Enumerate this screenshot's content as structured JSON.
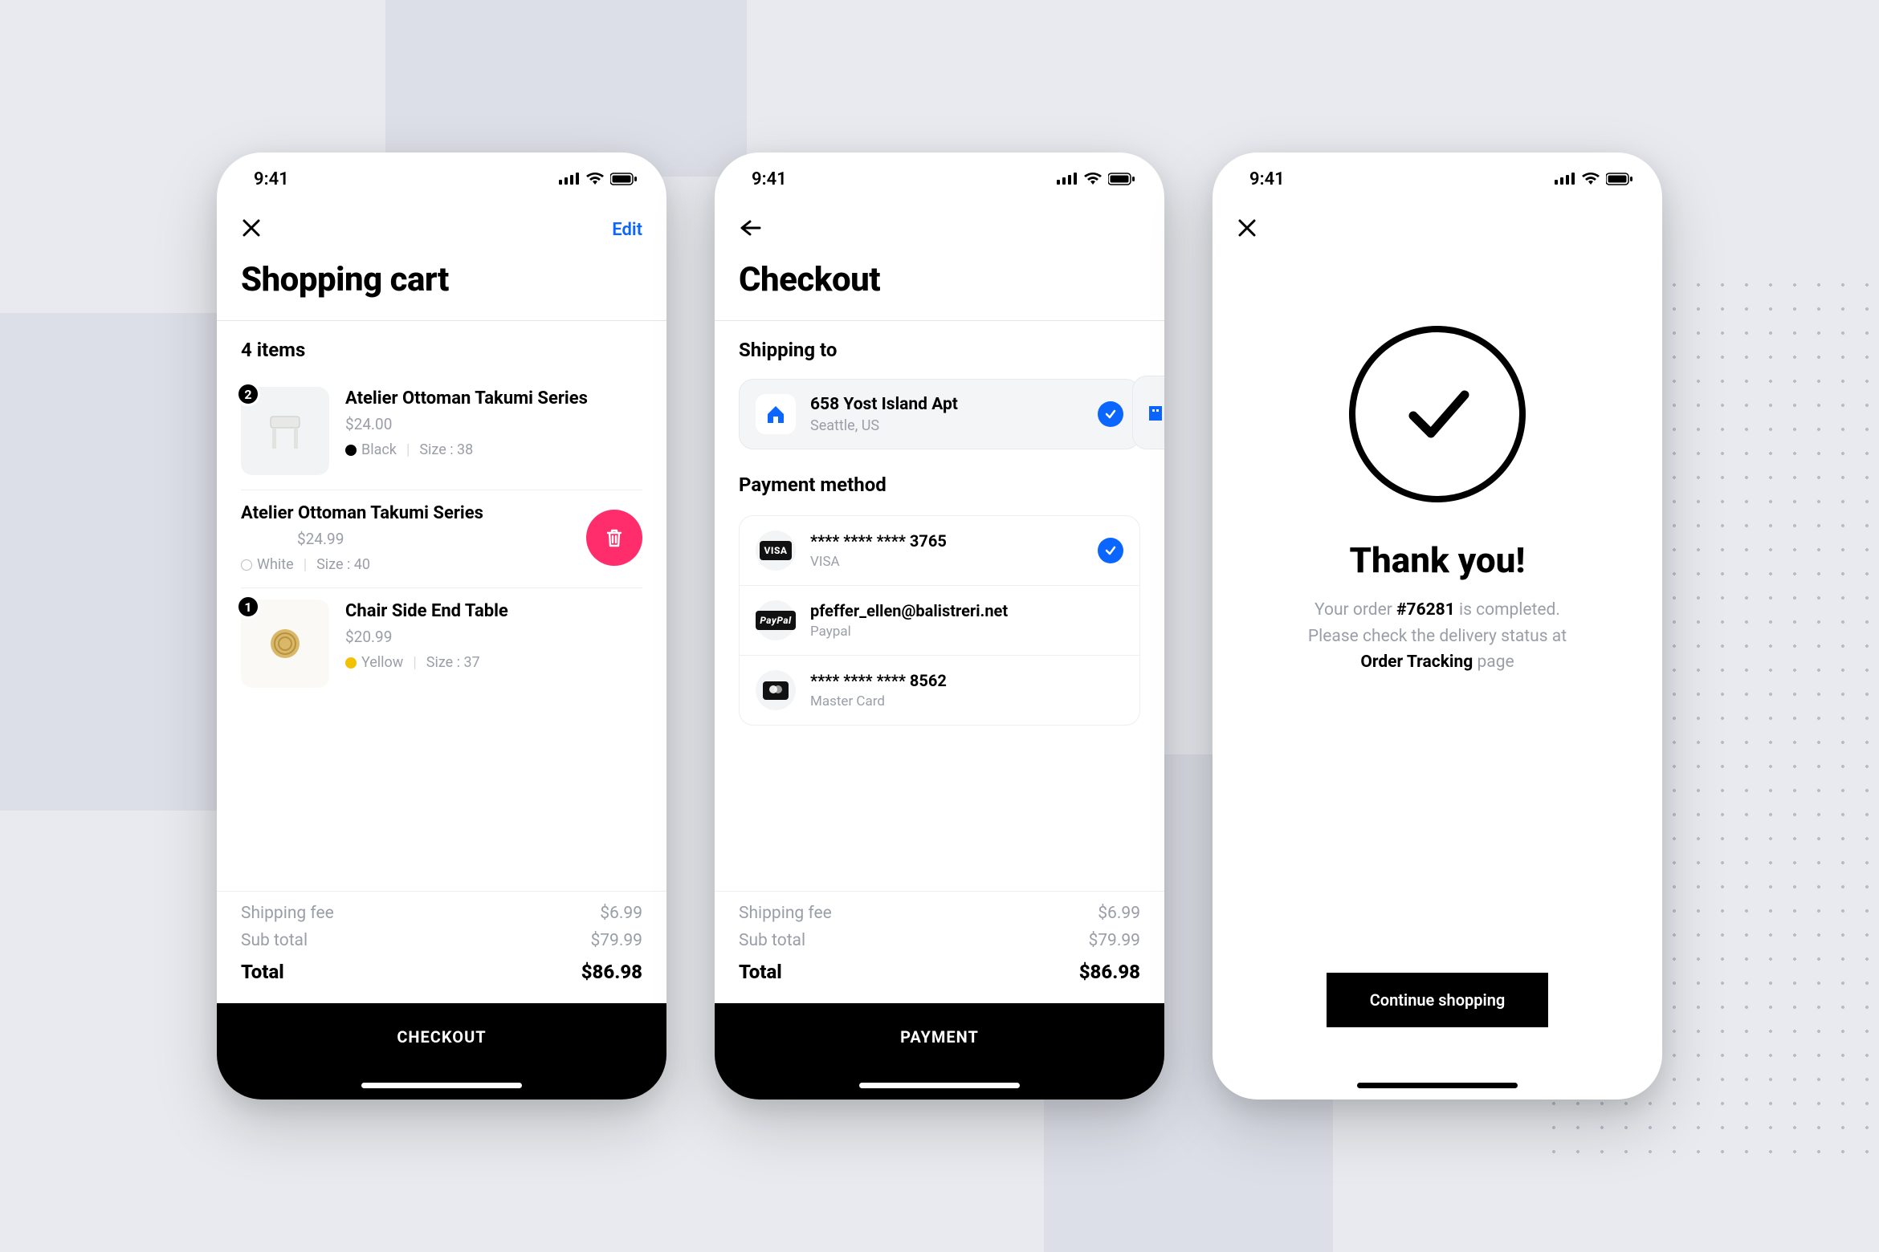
{
  "status": {
    "time": "9:41"
  },
  "colors": {
    "accent": "#0a66ff",
    "danger": "#ff2d6b"
  },
  "cart": {
    "edit_label": "Edit",
    "title": "Shopping cart",
    "items_count_label": "4 items",
    "items": [
      {
        "qty": "2",
        "name": "Atelier Ottoman Takumi Series",
        "price": "$24.00",
        "color_label": "Black",
        "color_swatch": "black",
        "size_label": "Size : 38"
      },
      {
        "qty": "",
        "name": "Atelier Ottoman Takumi Series",
        "price": "$24.99",
        "color_label": "White",
        "color_swatch": "white",
        "size_label": "Size : 40",
        "swiped": true
      },
      {
        "qty": "1",
        "name": "Chair Side End Table",
        "price": "$20.99",
        "color_label": "Yellow",
        "color_swatch": "yellow",
        "size_label": "Size : 37"
      }
    ],
    "summary": {
      "shipping_label": "Shipping fee",
      "shipping_value": "$6.99",
      "subtotal_label": "Sub total",
      "subtotal_value": "$79.99",
      "total_label": "Total",
      "total_value": "$86.98"
    },
    "cta": "CHECKOUT"
  },
  "checkout": {
    "title": "Checkout",
    "shipping_label": "Shipping to",
    "address": {
      "line1": "658 Yost Island Apt",
      "line2": "Seattle, US",
      "selected": true
    },
    "payment_label": "Payment method",
    "methods": [
      {
        "badge": "VISA",
        "title": "**** **** **** 3765",
        "sub": "VISA",
        "selected": true
      },
      {
        "badge": "PayPal",
        "title": "pfeffer_ellen@balistreri.net",
        "sub": "Paypal",
        "selected": false
      },
      {
        "badge": "mc",
        "title": "**** **** **** 8562",
        "sub": "Master Card",
        "selected": false
      }
    ],
    "summary": {
      "shipping_label": "Shipping fee",
      "shipping_value": "$6.99",
      "subtotal_label": "Sub total",
      "subtotal_value": "$79.99",
      "total_label": "Total",
      "total_value": "$86.98"
    },
    "cta": "PAYMENT"
  },
  "thankyou": {
    "title": "Thank you!",
    "line1_pre": "Your order ",
    "order": "#76281",
    "line1_post": " is completed.",
    "line2": "Please check the delivery status at",
    "tracking_label": "Order Tracking",
    "line2_post": " page",
    "cta": "Continue shopping"
  }
}
